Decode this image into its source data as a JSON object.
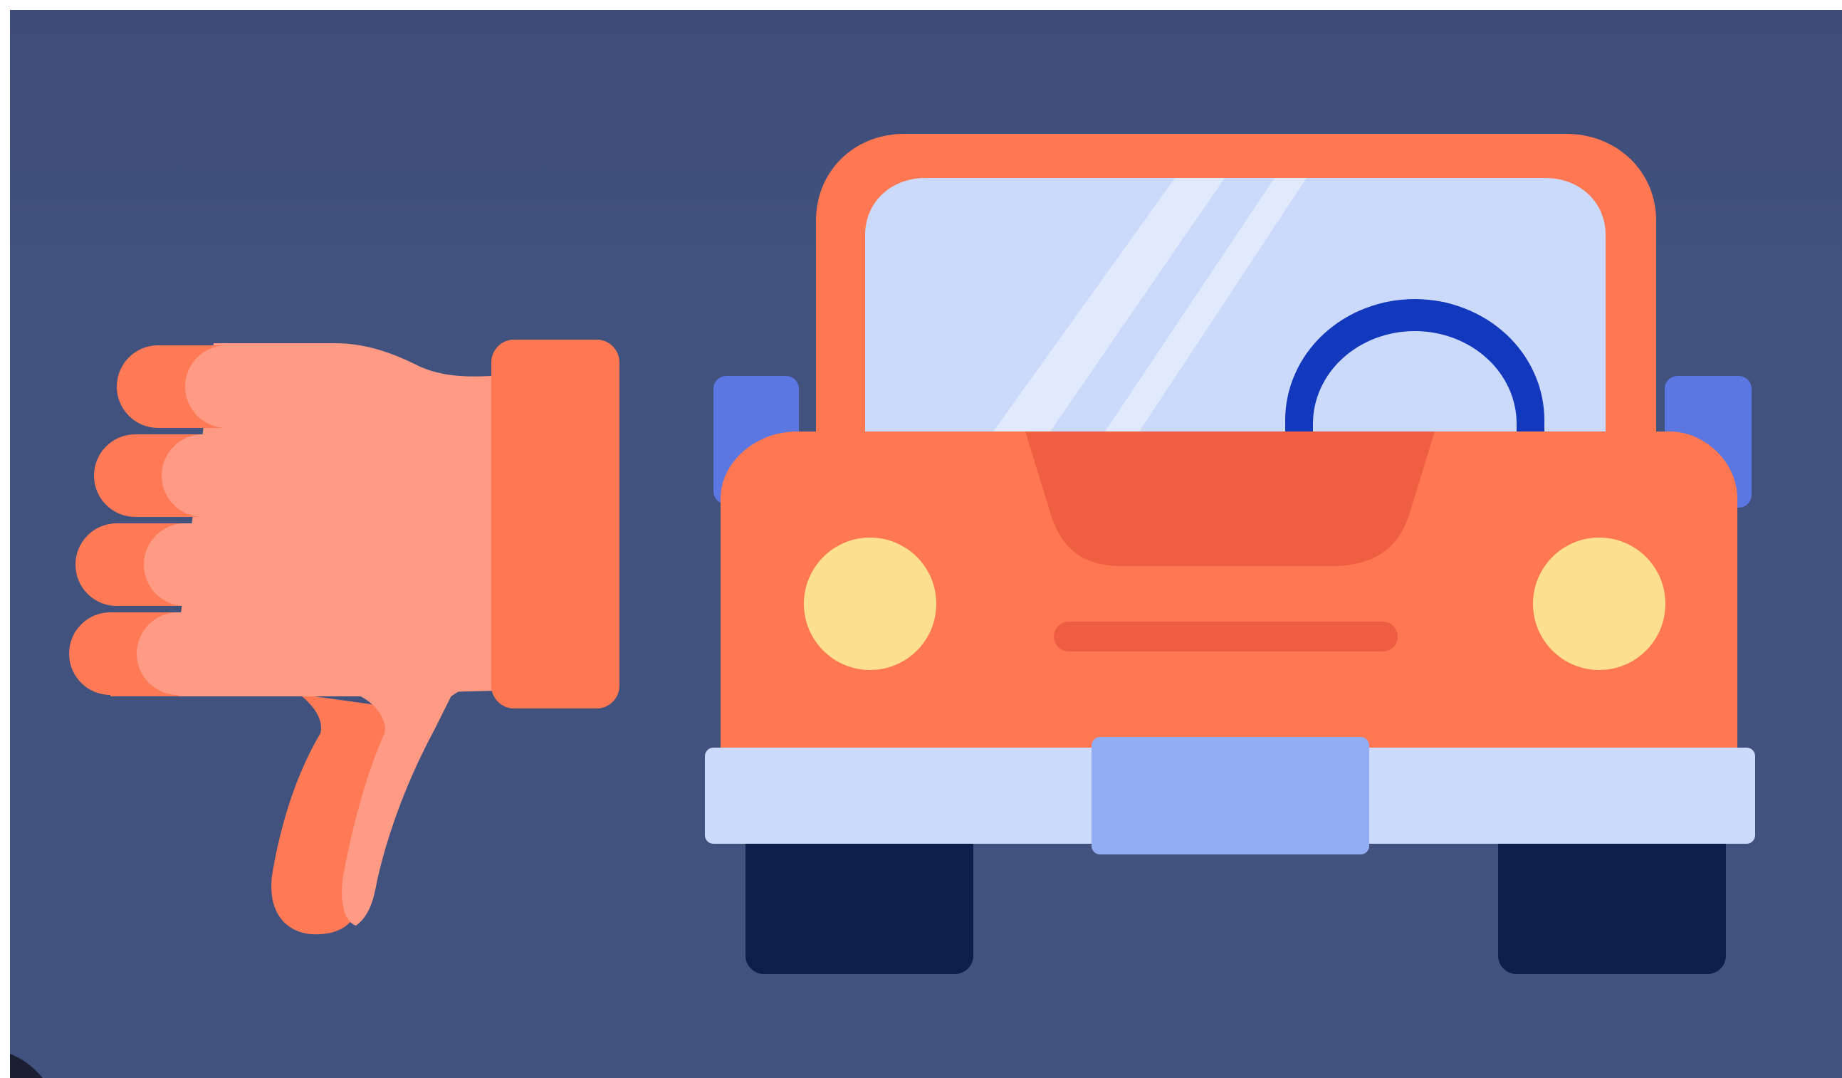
{
  "scene": {
    "description_icons": [
      "thumbs-down-icon",
      "car-front-icon"
    ],
    "colors": {
      "background": "#42527F",
      "background_top": "#3E4D78",
      "hand_main": "#FF9A85",
      "hand_shadow": "#FF7A55",
      "cuff": "#FF7852",
      "car_body": "#FF7852",
      "car_hood": "#F05E42",
      "windshield": "#CBDAFA",
      "windshield_glare": "#E1EAFD",
      "steering_wheel": "#1238BE",
      "mirror": "#5B78E2",
      "headlight": "#FDE08E",
      "bumper": "#CCDAFB",
      "license_plate": "#93ADF5",
      "tire": "#0C1F4B",
      "grille": "#EE5D42"
    }
  }
}
